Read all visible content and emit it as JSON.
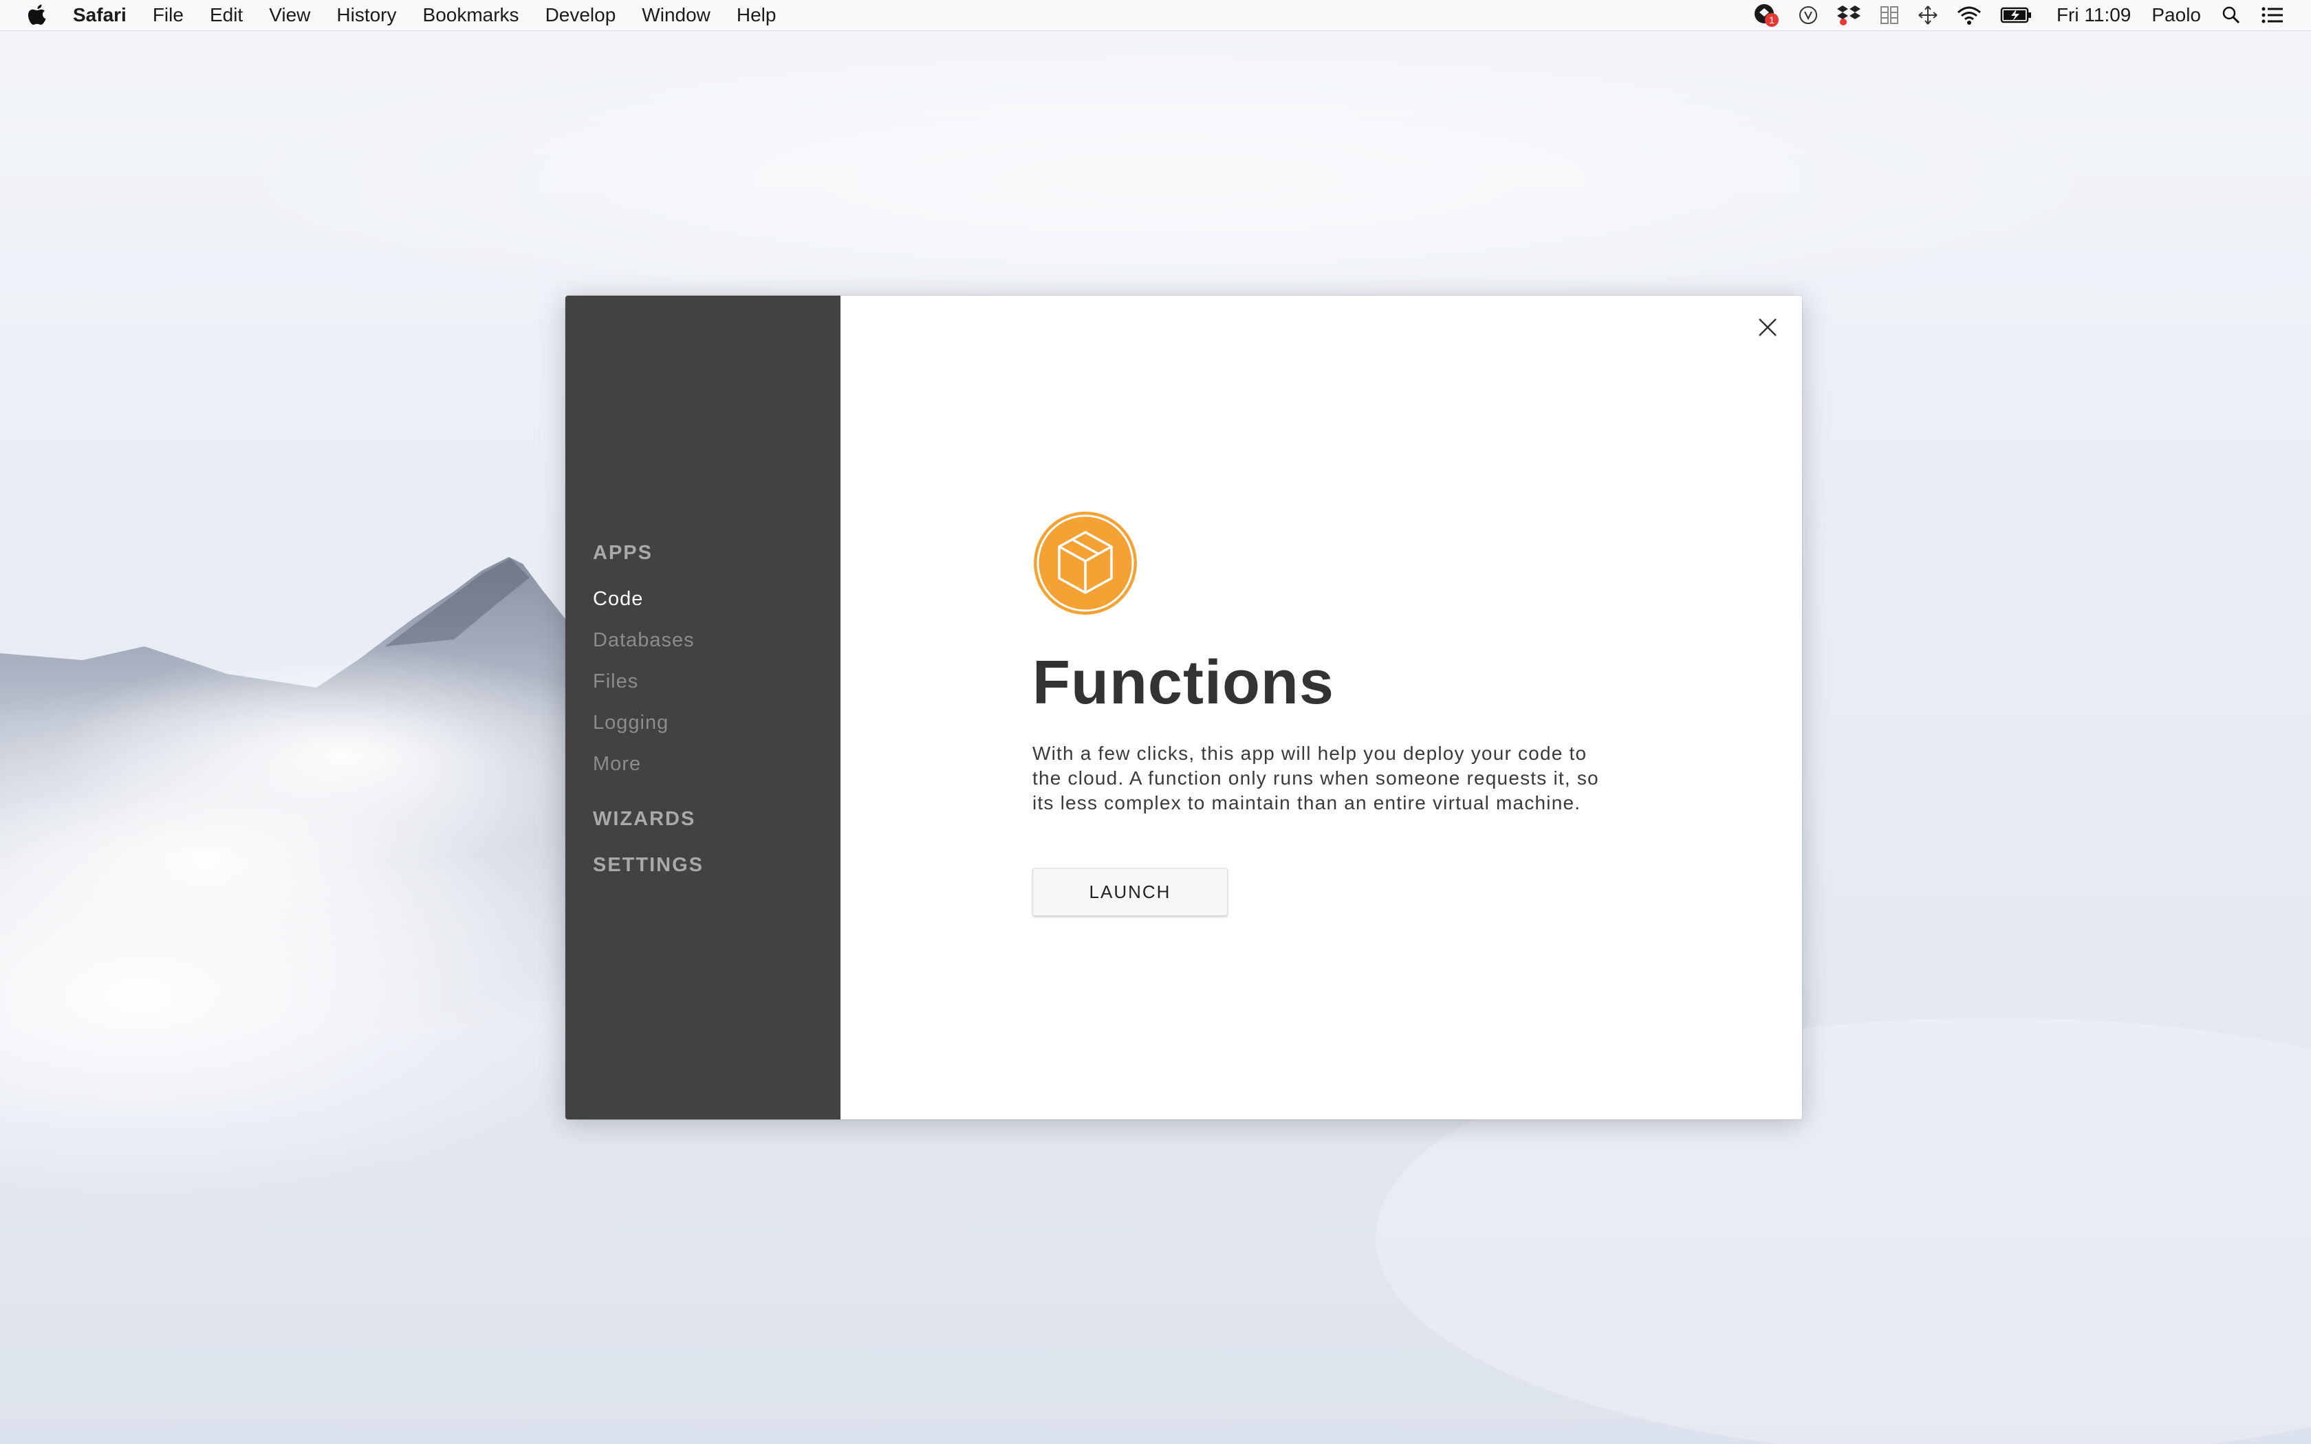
{
  "menubar": {
    "app_name": "Safari",
    "items": [
      "File",
      "Edit",
      "View",
      "History",
      "Bookmarks",
      "Develop",
      "Window",
      "Help"
    ],
    "status": {
      "notification_badge": "1",
      "clock": "Fri 11:09",
      "user": "Paolo"
    }
  },
  "sidebar": {
    "sections": {
      "apps": "APPS",
      "wizards": "WIZARDS",
      "settings": "SETTINGS"
    },
    "items": [
      "Code",
      "Databases",
      "Files",
      "Logging",
      "More"
    ],
    "active_item": "Code"
  },
  "main": {
    "icon": "package-box-icon",
    "accent_color": "#F4A233",
    "title": "Functions",
    "description": "With a few clicks, this app will help you deploy your code to the cloud. A function only runs when someone requests it, so its less complex to maintain than an entire virtual machine.",
    "launch_label": "LAUNCH"
  }
}
